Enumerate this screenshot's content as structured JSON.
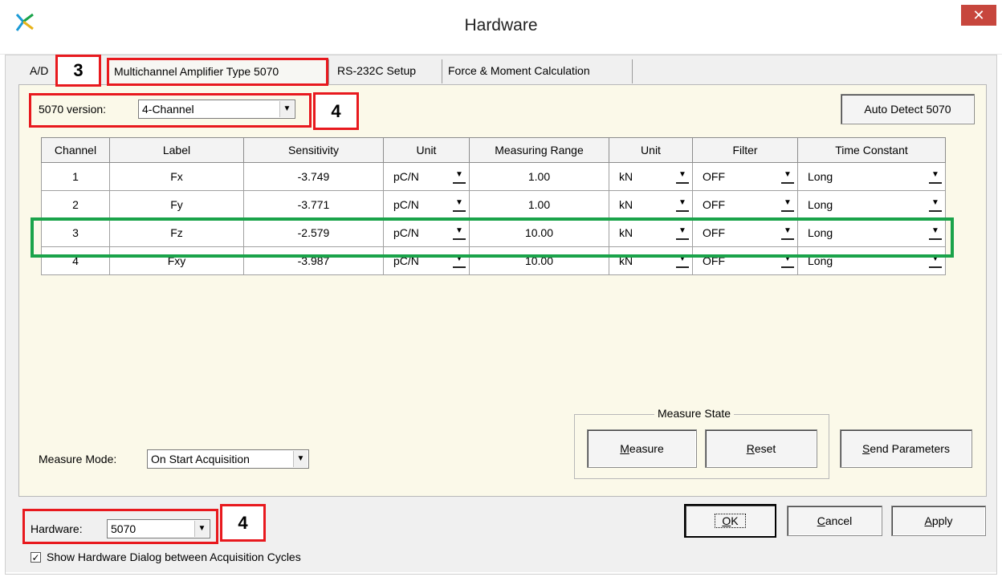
{
  "window": {
    "title": "Hardware",
    "close": "✕"
  },
  "tabs": [
    {
      "label": "A/D"
    },
    {
      "label": "Multichannel Amplifier Type 5070"
    },
    {
      "label": "RS-232C Setup"
    },
    {
      "label": "Force & Moment Calculation"
    }
  ],
  "version": {
    "label": "5070 version:",
    "value": "4-Channel"
  },
  "auto_detect_label": "Auto Detect 5070",
  "table": {
    "headers": [
      "Channel",
      "Label",
      "Sensitivity",
      "Unit",
      "Measuring Range",
      "Unit",
      "Filter",
      "Time Constant"
    ],
    "rows": [
      [
        "1",
        "Fx",
        "-3.749",
        "pC/N",
        "1.00",
        "kN",
        "OFF",
        "Long"
      ],
      [
        "2",
        "Fy",
        "-3.771",
        "pC/N",
        "1.00",
        "kN",
        "OFF",
        "Long"
      ],
      [
        "3",
        "Fz",
        "-2.579",
        "pC/N",
        "10.00",
        "kN",
        "OFF",
        "Long"
      ],
      [
        "4",
        "Fxy",
        "-3.987",
        "pC/N",
        "10.00",
        "kN",
        "OFF",
        "Long"
      ]
    ]
  },
  "measure_mode": {
    "label": "Measure Mode:",
    "value": "On Start Acquisition"
  },
  "measure_state": {
    "title": "Measure State",
    "measure_prefix": "M",
    "measure_rest": "easure",
    "reset_prefix": "R",
    "reset_rest": "eset"
  },
  "send_parameters": {
    "prefix": "S",
    "rest": "end Parameters"
  },
  "hardware": {
    "label": "Hardware:",
    "value": "5070"
  },
  "buttons": {
    "ok_prefix": "O",
    "ok_rest": "K",
    "cancel_prefix": "C",
    "cancel_rest": "ancel",
    "apply_prefix": "A",
    "apply_rest": "pply"
  },
  "show_dialog": {
    "checked": "✓",
    "label": "Show Hardware Dialog between Acquisition Cycles"
  },
  "annotations": {
    "tab": "3",
    "version": "4",
    "hardware": "4"
  },
  "colors": {
    "annotation_red": "#e8191e",
    "highlight_green": "#1aa34a",
    "panel_bg": "#fbf9e9",
    "close_bg": "#c7463d"
  }
}
